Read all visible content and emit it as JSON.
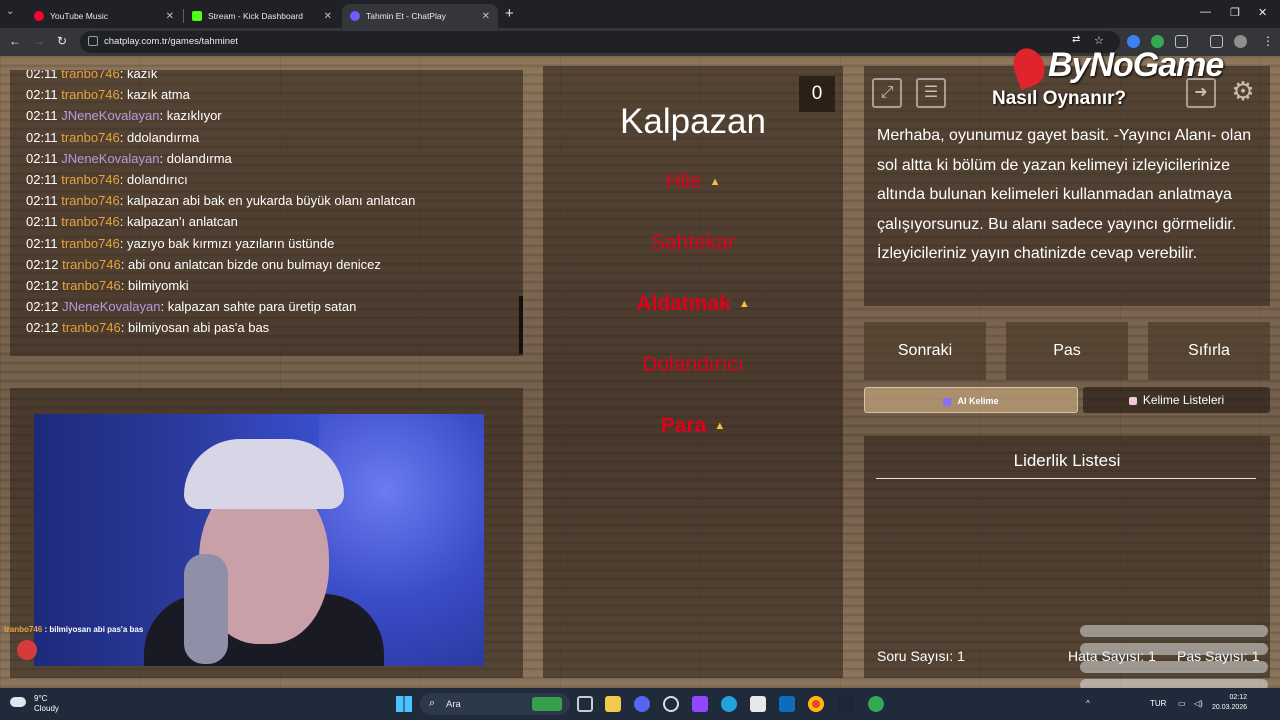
{
  "browser": {
    "tabs": [
      {
        "title": "YouTube Music",
        "color": "#ff0033"
      },
      {
        "title": "Stream - Kick Dashboard",
        "color": "#53fc18"
      },
      {
        "title": "Tahmin Et - ChatPlay",
        "color": "#6b5cff"
      }
    ],
    "url": "chatplay.com.tr/games/tahminet"
  },
  "chat": {
    "messages": [
      {
        "time": "02:11",
        "user": "tranbo746",
        "text": ": kazık"
      },
      {
        "time": "02:11",
        "user": "tranbo746",
        "text": ": kazık atma"
      },
      {
        "time": "02:11",
        "user": "JNeneKovalayan",
        "text": ": kazıklıyor"
      },
      {
        "time": "02:11",
        "user": "tranbo746",
        "text": ": ddolandırma"
      },
      {
        "time": "02:11",
        "user": "JNeneKovalayan",
        "text": ": dolandırma"
      },
      {
        "time": "02:11",
        "user": "tranbo746",
        "text": ": dolandırıcı"
      },
      {
        "time": "02:11",
        "user": "tranbo746",
        "text": ": kalpazan abi bak en yukarda büyük olanı anlatcan"
      },
      {
        "time": "02:11",
        "user": "tranbo746",
        "text": ": kalpazan'ı anlatcan"
      },
      {
        "time": "02:11",
        "user": "tranbo746",
        "text": ": yazıyo bak kırmızı yazıların üstünde"
      },
      {
        "time": "02:12",
        "user": "tranbo746",
        "text": ": abi onu anlatcan bizde onu bulmayı denicez"
      },
      {
        "time": "02:12",
        "user": "tranbo746",
        "text": ": bilmiyomki"
      },
      {
        "time": "02:12",
        "user": "JNeneKovalayan",
        "text": ": kalpazan sahte para üretip satan"
      },
      {
        "time": "02:12",
        "user": "tranbo746",
        "text": ": bilmiyosan abi pas'a bas"
      }
    ],
    "overlay_user": "tranbo746",
    "overlay_text": " : bilmiyosan abi pas'a bas"
  },
  "game": {
    "word": "Kalpazan",
    "counter": "0",
    "forbidden": [
      {
        "text": "Hile",
        "warn": true,
        "bold": false
      },
      {
        "text": "Sahtekar",
        "warn": false,
        "bold": false
      },
      {
        "text": "Aldatmak",
        "warn": true,
        "bold": true
      },
      {
        "text": "Dolandırıcı",
        "warn": false,
        "bold": false
      },
      {
        "text": "Para",
        "warn": true,
        "bold": true
      }
    ]
  },
  "brand": "ByNoGame",
  "info": {
    "title": "Nasıl Oynanır?",
    "text": "Merhaba, oyunumuz gayet basit. -Yayıncı Alanı- olan sol altta ki bölüm de yazan kelimeyi izleyicilerinize altında bulunan kelimeleri kullanmadan anlatmaya çalışıyorsunuz. Bu alanı sadece yayıncı görmelidir. İzleyicileriniz yayın chatinizde cevap verebilir."
  },
  "controls": {
    "next": "Sonraki",
    "pass": "Pas",
    "reset": "Sıfırla",
    "ai_word": "AI Kelime",
    "word_lists": "Kelime Listeleri"
  },
  "leaderboard": {
    "title": "Liderlik Listesi",
    "questions": "Soru Sayısı: 1",
    "errors": "Hata Sayısı: 1",
    "passes": "Pas Sayısı: 1"
  },
  "taskbar": {
    "temp": "9°C",
    "weather": "Cloudy",
    "search": "Ara",
    "lang": "TUR",
    "time": "02:12",
    "date": "20.03.2026"
  }
}
